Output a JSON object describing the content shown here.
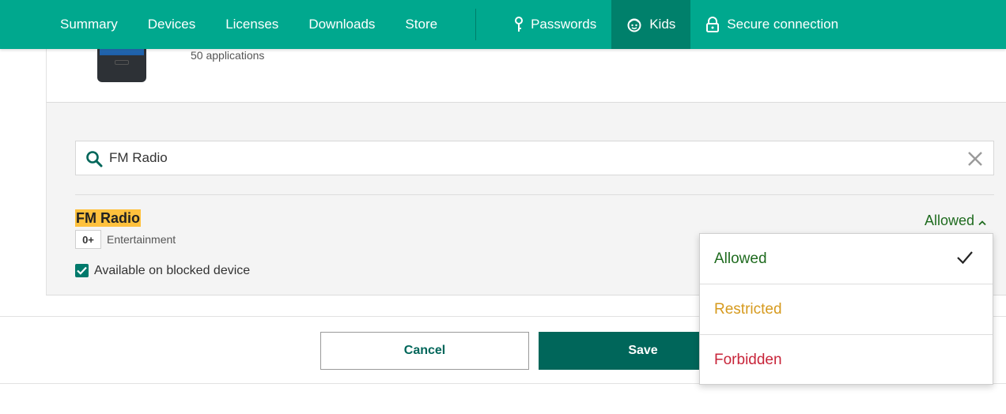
{
  "nav": {
    "items": [
      {
        "label": "Summary"
      },
      {
        "label": "Devices"
      },
      {
        "label": "Licenses"
      },
      {
        "label": "Downloads"
      },
      {
        "label": "Store"
      }
    ],
    "right_items": [
      {
        "label": "Passwords",
        "icon": "key-icon"
      },
      {
        "label": "Kids",
        "icon": "kids-icon",
        "active": true
      },
      {
        "label": "Secure connection",
        "icon": "lock-icon"
      }
    ]
  },
  "device": {
    "apps_count": "50 applications"
  },
  "search": {
    "value": "FM Radio"
  },
  "app": {
    "name": "FM Radio",
    "age_rating": "0+",
    "category": "Entertainment",
    "blocked_device_label": "Available on blocked device",
    "blocked_device_checked": true,
    "status": "Allowed"
  },
  "status_menu": {
    "options": [
      {
        "label": "Allowed",
        "color": "#1f6b1f",
        "selected": true
      },
      {
        "label": "Restricted",
        "color": "#d69a1e"
      },
      {
        "label": "Forbidden",
        "color": "#c8253a"
      }
    ]
  },
  "actions": {
    "cancel_label": "Cancel",
    "save_label": "Save"
  },
  "colors": {
    "brand": "#00a88e",
    "brand_dark": "#00665a",
    "highlight": "#ffc13d"
  }
}
